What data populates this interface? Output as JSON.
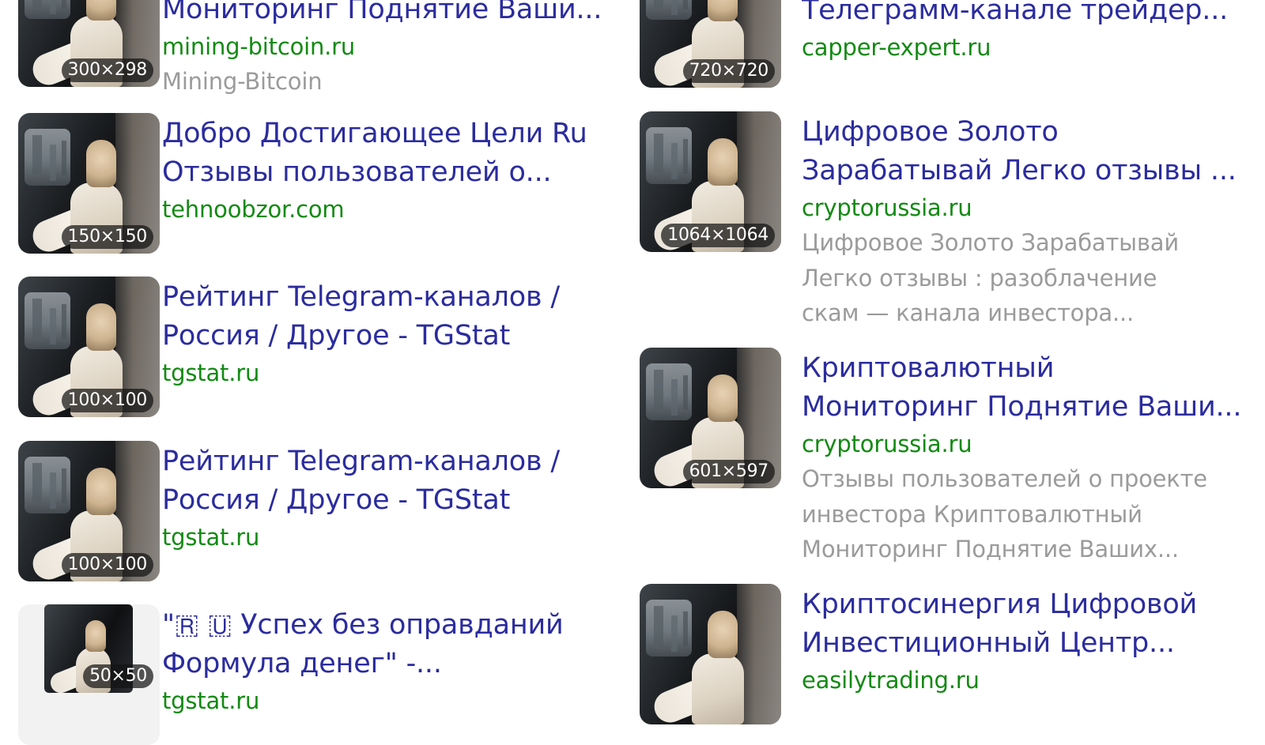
{
  "left_results": [
    {
      "badge": "300×298",
      "title_lines": [
        "Мониторинг Поднятие Ваши..."
      ],
      "domain": "mining-bitcoin.ru",
      "source": "Mining-Bitcoin"
    },
    {
      "badge": "150×150",
      "title_lines": [
        "Добро Достигающее Цели Ru",
        "Отзывы пользователей о..."
      ],
      "domain": "tehnoobzor.com"
    },
    {
      "badge": "100×100",
      "title_lines": [
        "Рейтинг Telegram-каналов /",
        "Россия / Другое - TGStat"
      ],
      "domain": "tgstat.ru"
    },
    {
      "badge": "100×100",
      "title_lines": [
        "Рейтинг Telegram-каналов /",
        "Россия / Другое - TGStat"
      ],
      "domain": "tgstat.ru"
    },
    {
      "badge": "50×50",
      "title_lines": [
        "\"🇷 🇺 Успех без оправданий",
        "Формула денег\" -..."
      ],
      "domain": "tgstat.ru"
    }
  ],
  "right_results": [
    {
      "badge": "720×720",
      "title_lines": [
        "Телеграмм-канале трейдер..."
      ],
      "domain": "capper-expert.ru"
    },
    {
      "badge": "1064×1064",
      "title_lines": [
        "Цифровое Золото",
        "Зарабатывай Легко отзывы ..."
      ],
      "domain": "cryptorussia.ru",
      "snippet_lines": [
        "Цифровое Золото Зарабатывай",
        "Легко отзывы : разоблачение",
        "скам — канала инвестора..."
      ]
    },
    {
      "badge": "601×597",
      "title_lines": [
        "Криптовалютный",
        "Мониторинг Поднятие Ваши..."
      ],
      "domain": "cryptorussia.ru",
      "snippet_lines": [
        "Отзывы пользователей о проекте",
        "инвестора Криптовалютный",
        "Мониторинг Поднятие Ваших..."
      ]
    },
    {
      "badge": "",
      "title_lines": [
        "Криптосинергия Цифровой",
        "Инвестиционный Центр..."
      ],
      "domain": "easilytrading.ru"
    }
  ]
}
